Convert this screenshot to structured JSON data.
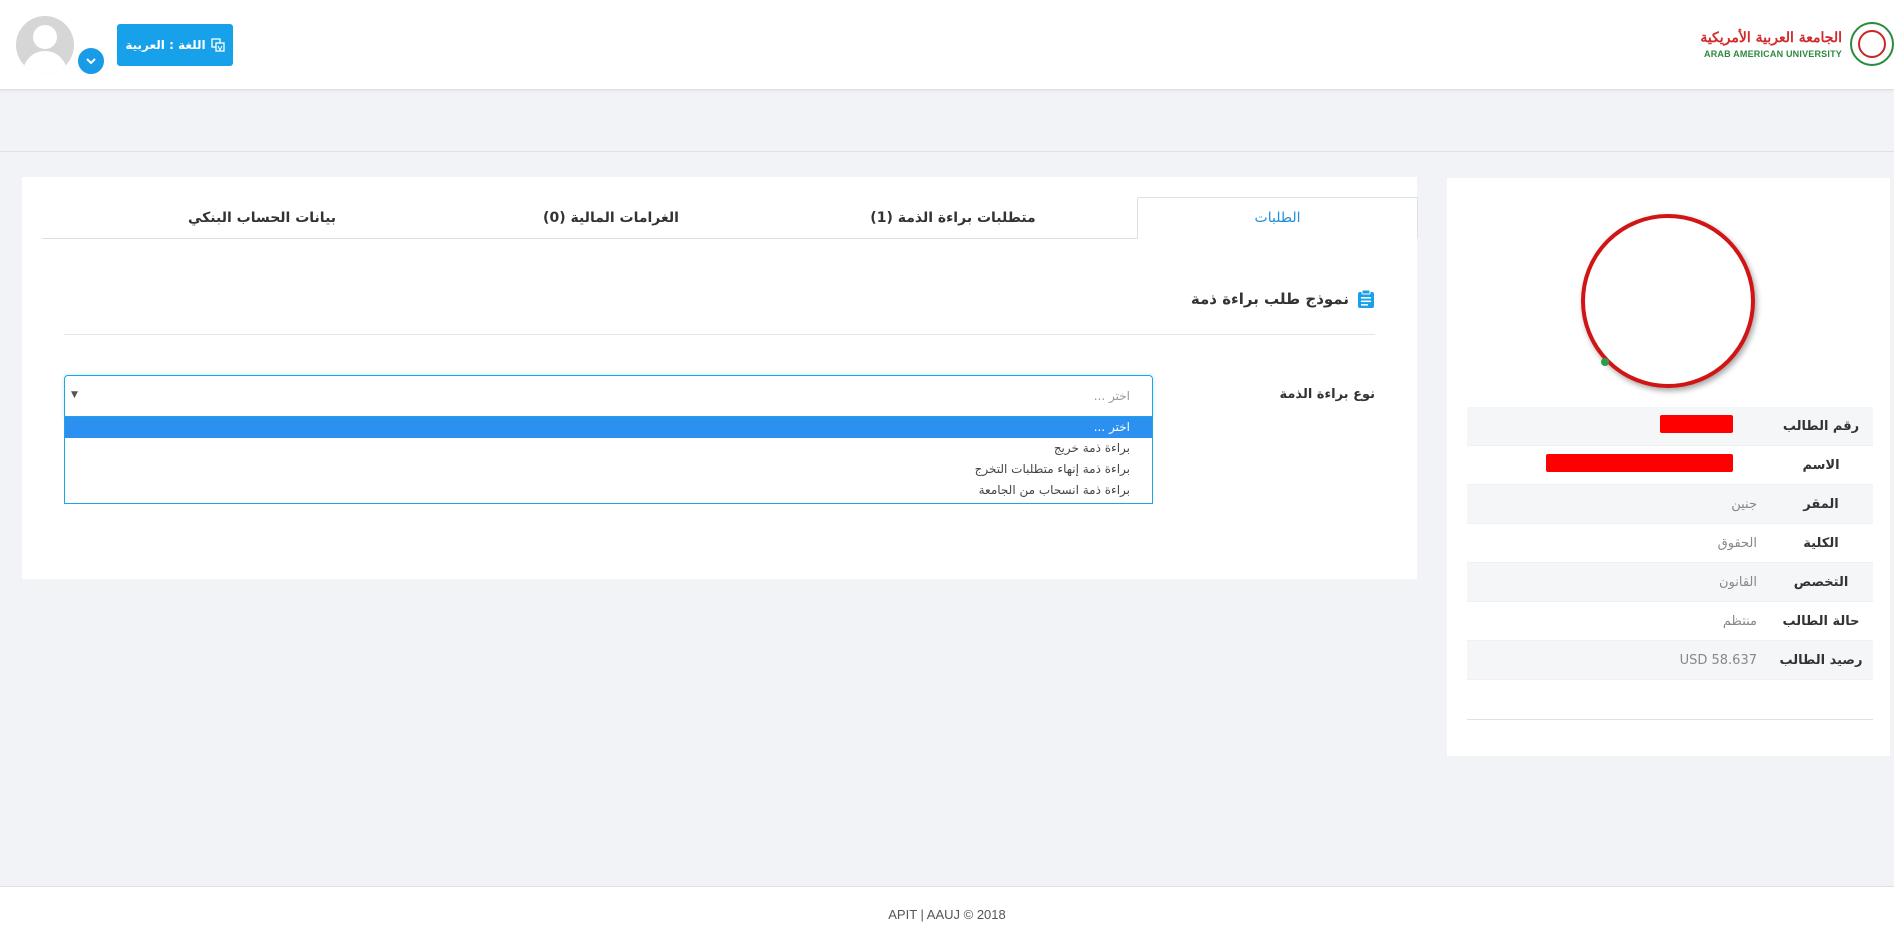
{
  "header": {
    "language_button": "اللغة : العربية",
    "logo_arabic": "الجامعة العربية الأمريكية",
    "logo_english": "ARAB AMERICAN UNIVERSITY"
  },
  "tabs": [
    {
      "label": "الطلبات"
    },
    {
      "label": "متطلبات براءة الذمة (1)"
    },
    {
      "label": "الغرامات المالية (0)"
    },
    {
      "label": "بيانات الحساب البنكي"
    }
  ],
  "form": {
    "title": "نموذج طلب براءة ذمة",
    "field_label": "نوع براءة الذمة",
    "select_value": "اختر ...",
    "options": [
      "اختر ...",
      "براءة ذمة خريج",
      "براءة ذمة إنهاء متطلبات التخرج",
      "براءة ذمة انسحاب من الجامعة"
    ]
  },
  "profile": {
    "rows": [
      {
        "label": "رقم الطالب",
        "value": ""
      },
      {
        "label": "الاسم",
        "value": ""
      },
      {
        "label": "المقر",
        "value": "جنين"
      },
      {
        "label": "الكلية",
        "value": "الحقوق"
      },
      {
        "label": "التخصص",
        "value": "القانون"
      },
      {
        "label": "حالة الطالب",
        "value": "منتظم"
      },
      {
        "label": "رصيد الطالب",
        "value": "USD 58.637"
      }
    ]
  },
  "footer": {
    "text": "APIT | AAUJ © 2018"
  },
  "colors": {
    "accent": "#16a1ea",
    "active_tab": "#1e8fd8",
    "selected_option": "#2b90f0",
    "redaction": "#ff0000"
  }
}
